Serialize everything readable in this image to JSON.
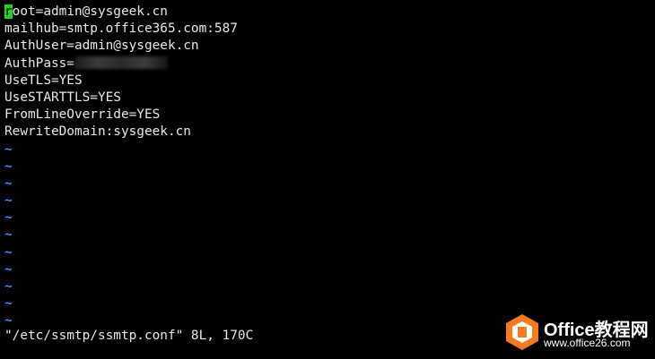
{
  "terminal": {
    "background": "#000000",
    "text_color": "#e8e8e8",
    "cursor_color": "#22d022",
    "tilde_color": "#3e8bff",
    "lines": [
      {
        "cursor_char": "r",
        "text": "oot=admin@sysgeek.cn"
      },
      {
        "text": "mailhub=smtp.office365.com:587"
      },
      {
        "text": "AuthUser=admin@sysgeek.cn"
      },
      {
        "text": "AuthPass="
      },
      {
        "text": "UseTLS=YES"
      },
      {
        "text": "UseSTARTTLS=YES"
      },
      {
        "text": "FromLineOverride=YES"
      },
      {
        "text": "RewriteDomain:sysgeek.cn"
      }
    ],
    "empty_line_marker": "~",
    "status_line": "\"/etc/ssmtp/ssmtp.conf\" 8L, 170C"
  },
  "watermark": {
    "brand": "Office教程网",
    "url": "www.office26.com",
    "logo_color": "#f47b20"
  }
}
